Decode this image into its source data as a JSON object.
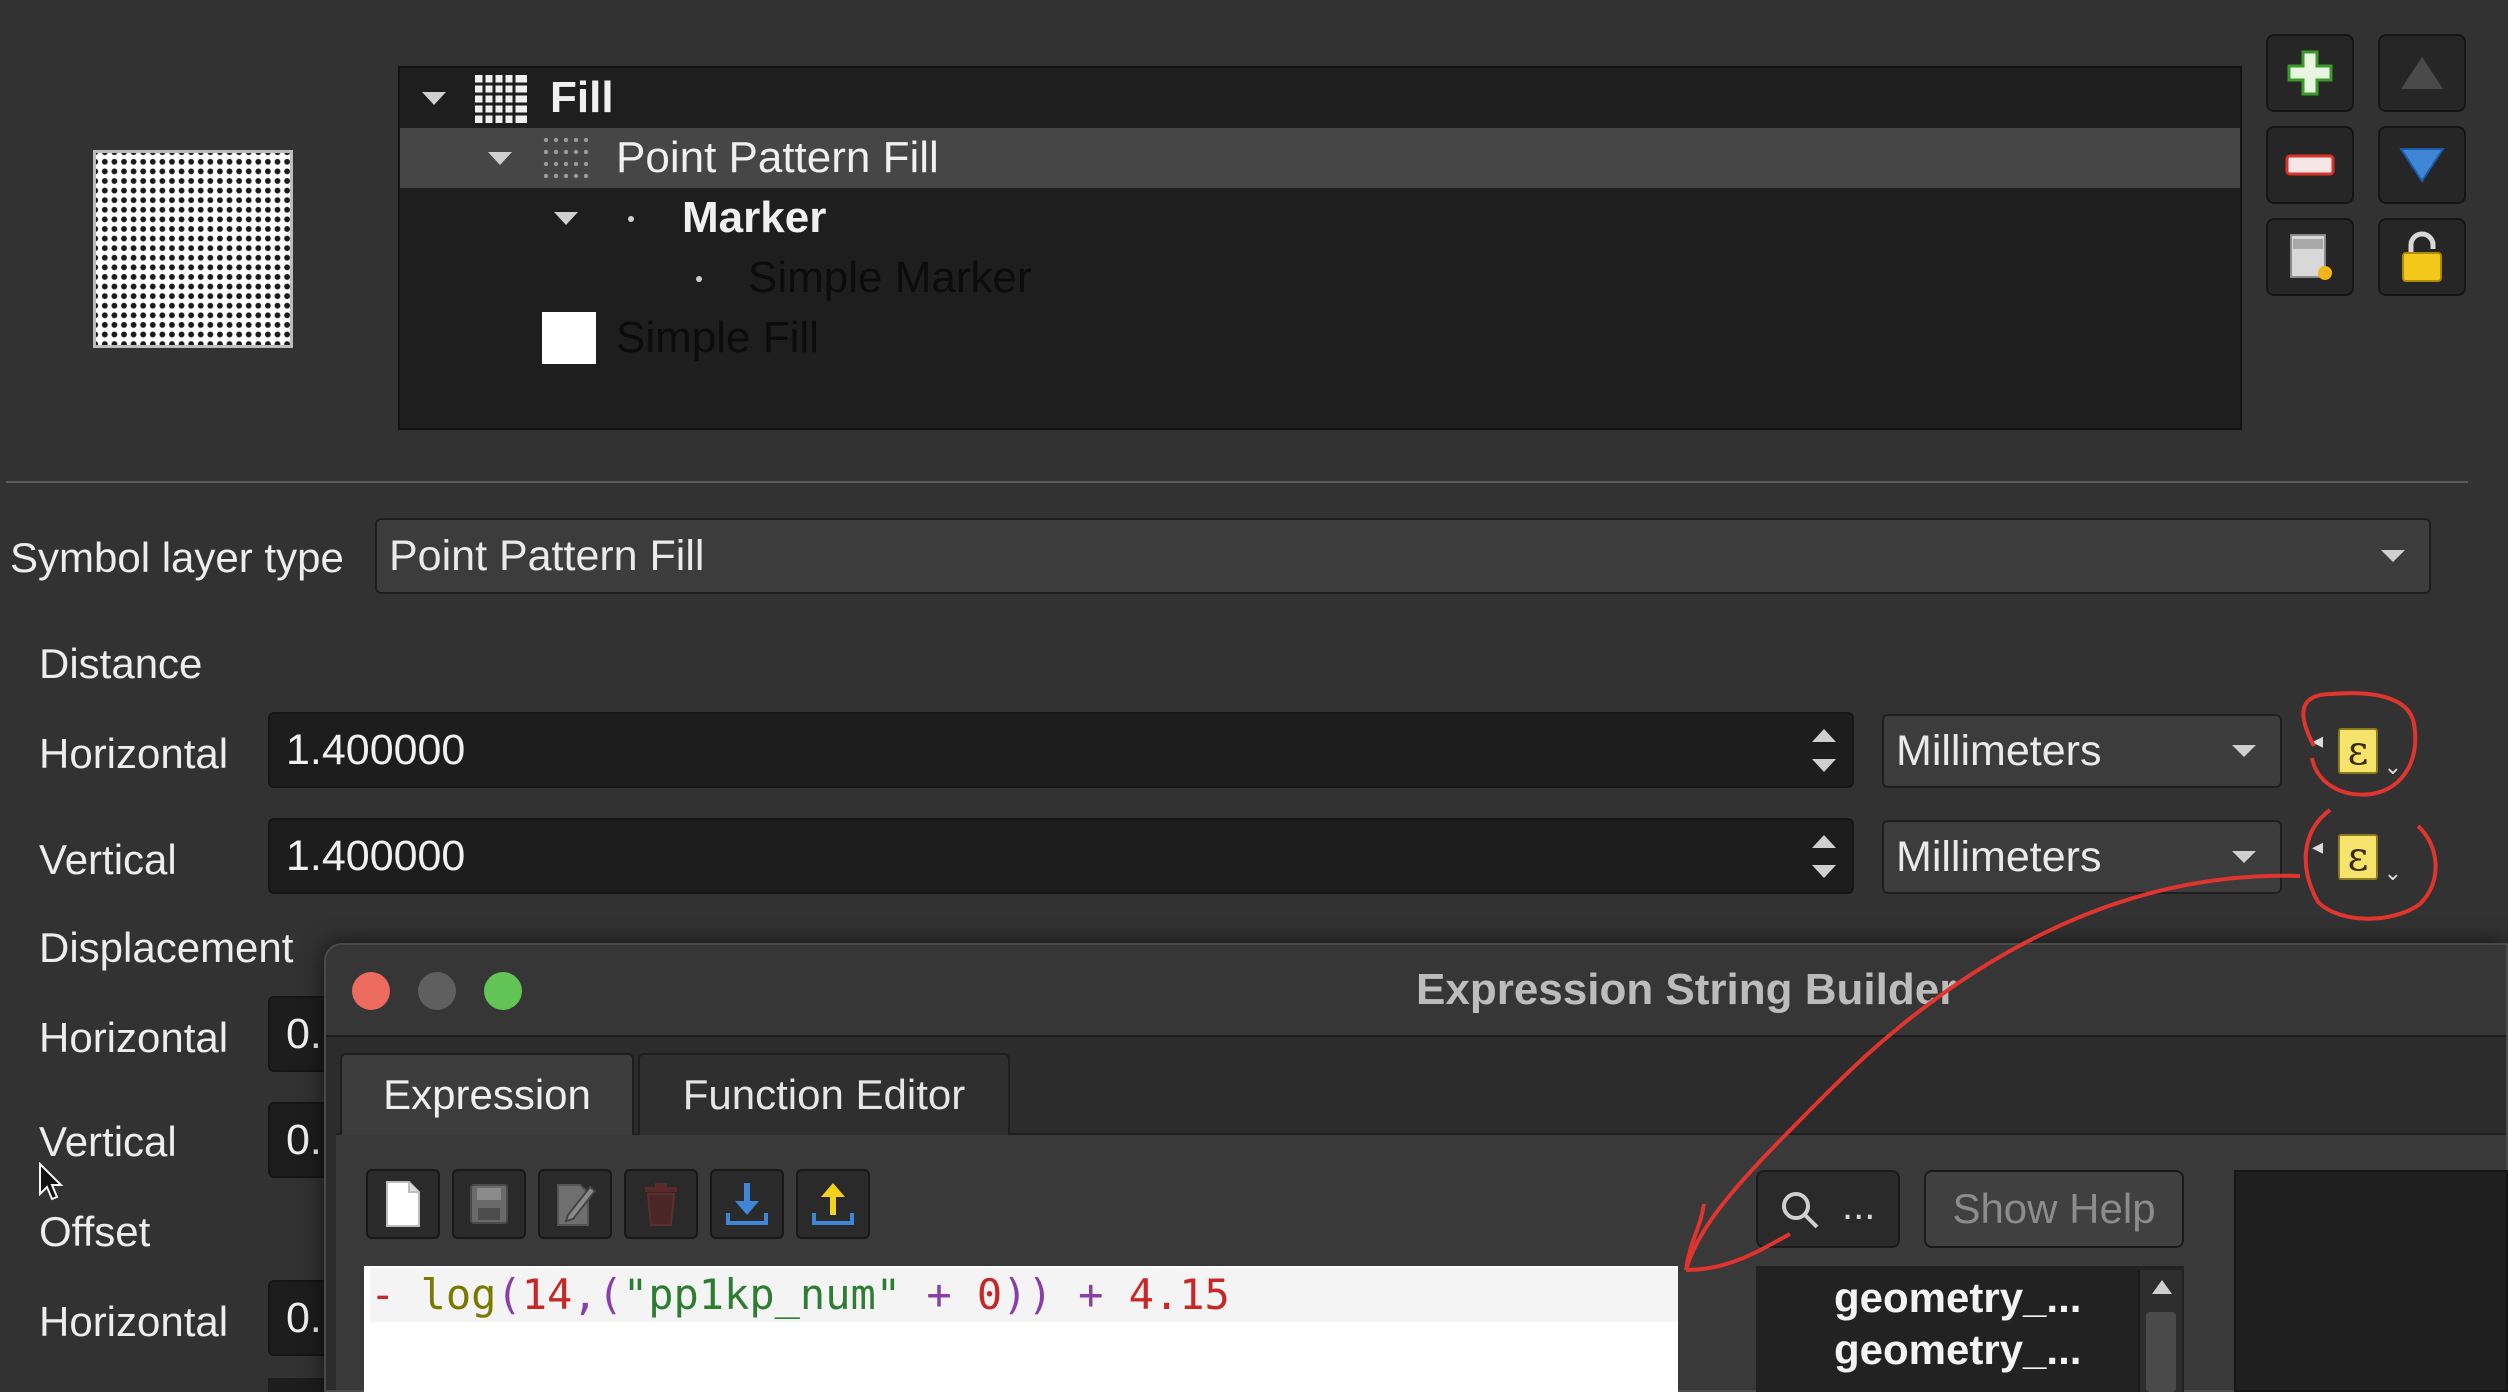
{
  "tree": {
    "items": [
      {
        "label": "Fill",
        "bold": true
      },
      {
        "label": "Point Pattern Fill",
        "bold": false
      },
      {
        "label": "Marker",
        "bold": true
      },
      {
        "label": "Simple Marker",
        "bold": false
      },
      {
        "label": "Simple Fill",
        "bold": false
      }
    ]
  },
  "side_buttons": [
    "add-layer-icon",
    "remove-layer-icon",
    "move-up-icon",
    "move-down-icon",
    "duplicate-layer-icon",
    "lock-icon"
  ],
  "form": {
    "symbol_layer_type_label": "Symbol layer type",
    "symbol_layer_type_value": "Point Pattern Fill",
    "distance_heading": "Distance",
    "horizontal_label": "Horizontal",
    "vertical_label": "Vertical",
    "distance_horizontal_value": "1.400000",
    "distance_vertical_value": "1.400000",
    "unit_value": "Millimeters",
    "displacement_heading": "Displacement",
    "offset_heading": "Offset",
    "partial_value": "0."
  },
  "dialog": {
    "title": "Expression String Builder",
    "tabs": [
      {
        "label": "Expression",
        "active": true
      },
      {
        "label": "Function Editor",
        "active": false
      }
    ],
    "toolbar_icons": [
      "new-file-icon",
      "save-icon",
      "edit-icon",
      "delete-icon",
      "import-icon",
      "export-icon"
    ],
    "expression": {
      "minus": "- ",
      "fn": "log",
      "open": "(",
      "num1": "14",
      "comma": ",",
      "open2": "(",
      "field": "\"pp1kp_num\"",
      "plus1": " + ",
      "num0": "0",
      "close": "))",
      "plus2": " + ",
      "num2": "4.15"
    },
    "search_placeholder": "...",
    "show_help_label": "Show Help",
    "function_list": [
      "geometry_...",
      "geometry_..."
    ]
  },
  "colors": {
    "accent_red_annotation": "#e0342f",
    "traffic_close": "#ed6a5e",
    "traffic_min": "#5f5f5f",
    "traffic_max": "#61c454",
    "expr_red": "#c62828",
    "expr_olive": "#7a7a00",
    "expr_purple": "#8a3fa8",
    "expr_green": "#2e7d32"
  }
}
